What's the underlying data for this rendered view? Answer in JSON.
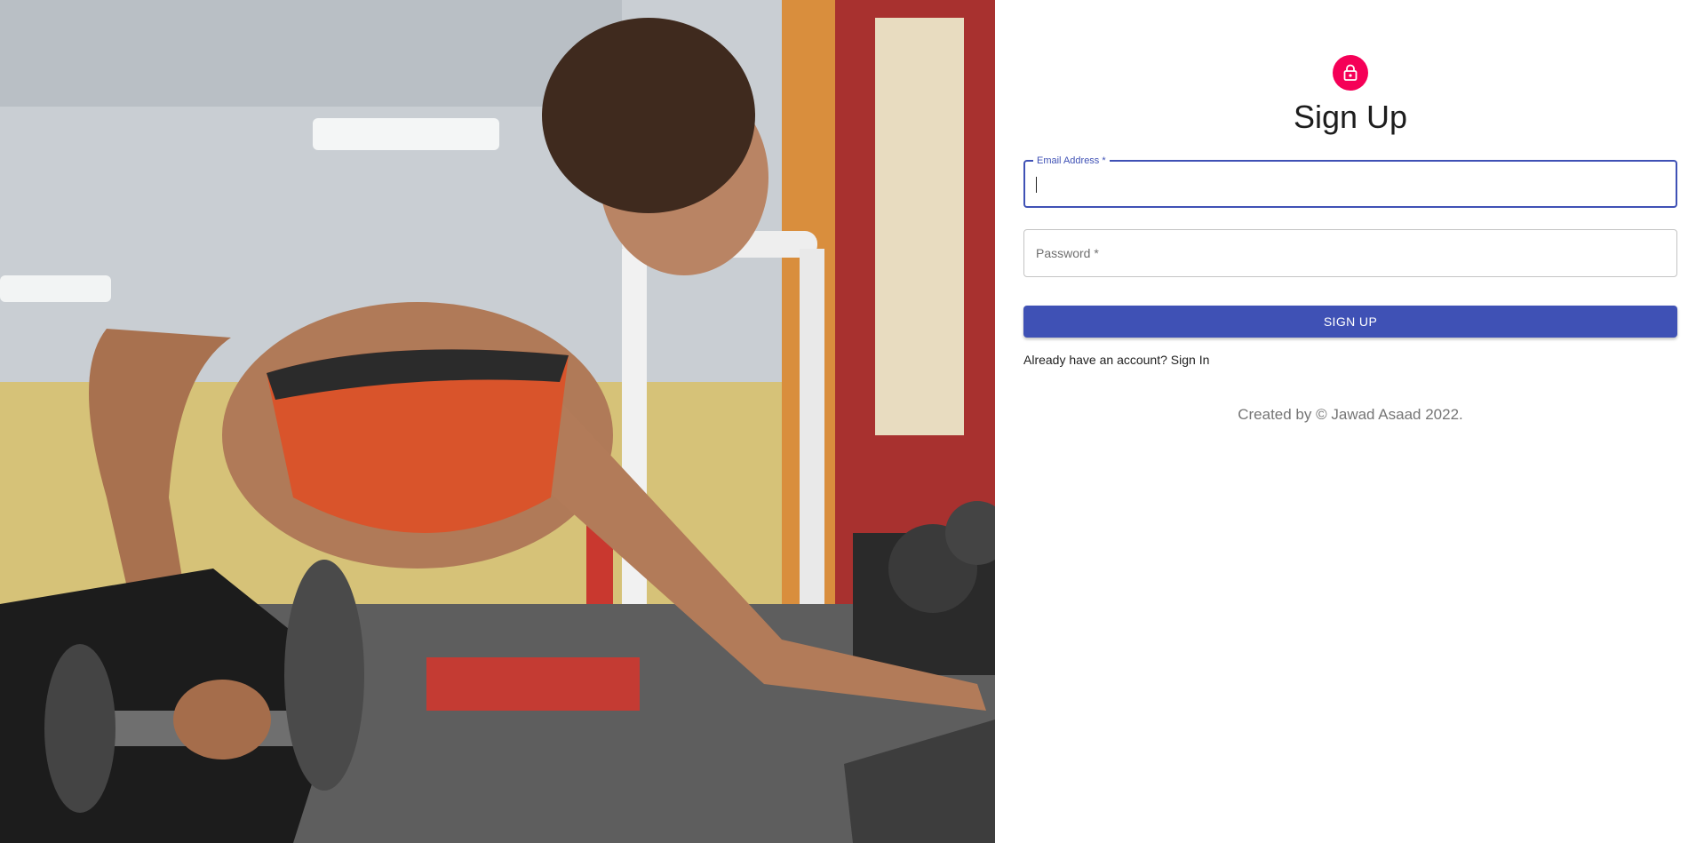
{
  "hero": {
    "image": "gym-woman-dumbbell-photo"
  },
  "avatar": {
    "icon": "lock-icon",
    "color": "#f50057"
  },
  "title": "Sign Up",
  "form": {
    "email": {
      "label": "Email Address *",
      "value": ""
    },
    "password": {
      "placeholder": "Password *",
      "value": ""
    },
    "submit_label": "SIGN UP",
    "signin_link": "Already have an account? Sign In"
  },
  "footer": "Created by © Jawad Asaad 2022.",
  "colors": {
    "primary": "#3f51b5",
    "accent": "#f50057"
  }
}
